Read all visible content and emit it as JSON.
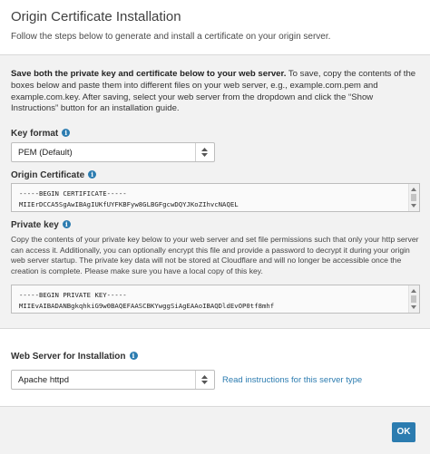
{
  "header": {
    "title": "Origin Certificate Installation",
    "subtitle": "Follow the steps below to generate and install a certificate on your origin server."
  },
  "intro": {
    "bold": "Save both the private key and certificate below to your web server.",
    "rest": " To save, copy the contents of the boxes below and paste them into different files on your web server, e.g., example.com.pem and example.com.key. After saving, select your web server from the dropdown and click the “Show Instructions” button for an installation guide."
  },
  "key_format": {
    "label": "Key format",
    "selected": "PEM (Default)"
  },
  "origin_certificate": {
    "label": "Origin Certificate",
    "line1": "-----BEGIN CERTIFICATE-----",
    "line2": "MIIErDCCA5SgAwIBAgIUKfUYFKBFyw8GLBGFgcwDQYJKoZIhvcNAQEL"
  },
  "private_key": {
    "label": "Private key",
    "description": "Copy the contents of your private key below to your web server and set file permissions such that only your http server can access it. Additionally, you can optionally encrypt this file and provide a password to decrypt it during your origin web server startup. The private key data will not be stored at Cloudflare and will no longer be accessible once the creation is complete. Please make sure you have a local copy of this key.",
    "line1": "-----BEGIN PRIVATE KEY-----",
    "line2": "MIIEvAIBADANBgkqhkiG9w0BAQEFAASCBKYwggSiAgEAAoIBAQDldEvOP0tf8mhf"
  },
  "web_server": {
    "label": "Web Server for Installation",
    "selected": "Apache httpd",
    "link": "Read instructions for this server type"
  },
  "footer": {
    "ok_label": "OK"
  },
  "colors": {
    "accent": "#2c7cb0",
    "panel_bg": "#f2f2f2"
  },
  "icons": {
    "info": "info-icon",
    "select_arrows": "updown-arrows-icon"
  }
}
